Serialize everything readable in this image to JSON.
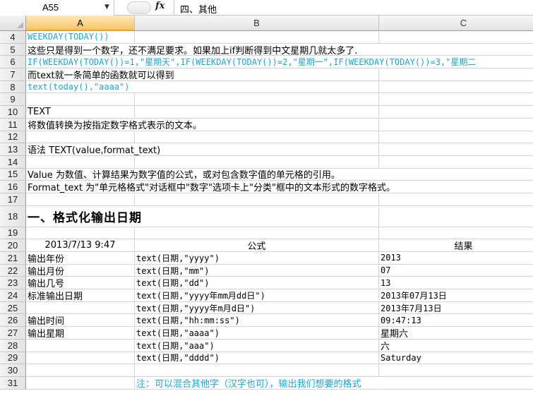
{
  "formula_bar": {
    "name_box": "A55",
    "fx_label": "fx",
    "content": "四、其他"
  },
  "columns": [
    "A",
    "B",
    "C"
  ],
  "rows": [
    {
      "num": "4",
      "a": "WEEKDAY(TODAY())"
    },
    {
      "num": "5",
      "a": "这些只是得到一个数字，还不满足要求。如果加上if判断得到中文星期几就太多了."
    },
    {
      "num": "6",
      "a": "IF(WEEKDAY(TODAY())=1,\"星期天\",IF(WEEKDAY(TODAY())=2,\"星期一\",IF(WEEKDAY(TODAY())=3,\"星期二"
    },
    {
      "num": "7",
      "a": "而text就一条简单的函数就可以得到"
    },
    {
      "num": "8",
      "a": "text(today(),\"aaaa\")"
    },
    {
      "num": "9",
      "a": ""
    },
    {
      "num": "10",
      "a": "TEXT"
    },
    {
      "num": "11",
      "a": "将数值转换为按指定数字格式表示的文本。"
    },
    {
      "num": "12",
      "a": ""
    },
    {
      "num": "13",
      "a": "语法   TEXT(value,format_text)"
    },
    {
      "num": "14",
      "a": ""
    },
    {
      "num": "15",
      "a": "Value    为数值、计算结果为数字值的公式，或对包含数字值的单元格的引用。"
    },
    {
      "num": "16",
      "a": "Format_text    为\"单元格格式\"对话框中\"数字\"选项卡上\"分类\"框中的文本形式的数字格式。"
    },
    {
      "num": "17",
      "a": ""
    },
    {
      "num": "18",
      "a": "一、格式化输出日期"
    },
    {
      "num": "19",
      "a": ""
    },
    {
      "num": "20",
      "a": "2013/7/13 9:47",
      "b": "公式",
      "c": "结果"
    },
    {
      "num": "21",
      "a": "输出年份",
      "b": "text(日期,\"yyyy\")",
      "c": "2013"
    },
    {
      "num": "22",
      "a": "输出月份",
      "b": "text(日期,\"mm\")",
      "c": "07"
    },
    {
      "num": "23",
      "a": "输出几号",
      "b": "text(日期,\"dd\")",
      "c": "13"
    },
    {
      "num": "24",
      "a": "标准输出日期",
      "b": "text(日期,\"yyyy年mm月dd日\")",
      "c": "2013年07月13日"
    },
    {
      "num": "25",
      "a": "",
      "b": "text(日期,\"yyyy年m月d日\")",
      "c": "2013年7月13日"
    },
    {
      "num": "26",
      "a": "输出时间",
      "b": "text(日期,\"hh:mm:ss\")",
      "c": "09:47:13"
    },
    {
      "num": "27",
      "a": "输出星期",
      "b": "text(日期,\"aaaa\")",
      "c": "星期六"
    },
    {
      "num": "28",
      "a": "",
      "b": "text(日期,\"aaa\")",
      "c": "六"
    },
    {
      "num": "29",
      "a": "",
      "b": "text(日期,\"dddd\")",
      "c": "Saturday"
    },
    {
      "num": "30",
      "a": ""
    },
    {
      "num": "31",
      "a": "",
      "b": "注：可以混合其他字（汉字也可），输出我们想要的格式"
    }
  ],
  "colors": {
    "formula_text": "#1aa7d6",
    "selected_col_header": "#f7c566"
  }
}
